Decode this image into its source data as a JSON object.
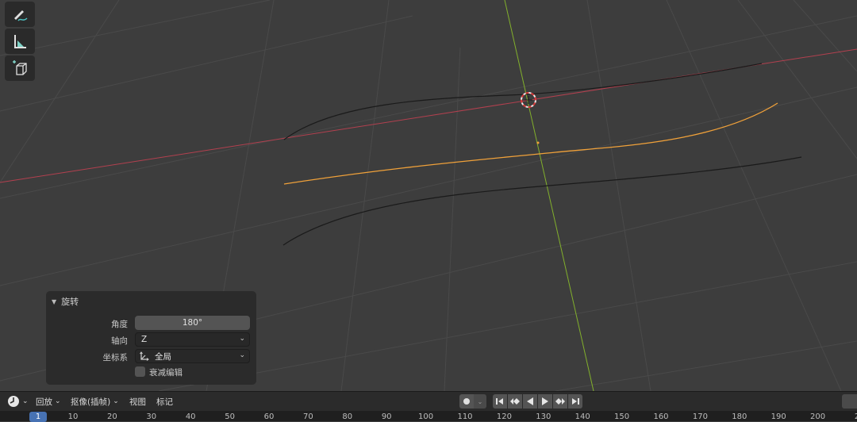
{
  "viewport": {
    "tools": [
      {
        "icon": "annotate-icon"
      },
      {
        "icon": "measure-icon"
      },
      {
        "icon": "add-cube-icon"
      }
    ]
  },
  "operator_panel": {
    "title": "旋转",
    "angle_label": "角度",
    "angle_value": "180°",
    "axis_label": "轴向",
    "axis_value": "Z",
    "orient_label": "坐标系",
    "orient_value": "全局",
    "proportional_label": "衰减编辑",
    "proportional_checked": false
  },
  "timeline": {
    "playback_label": "回放",
    "keying_label": "抠像(插帧)",
    "view_label": "视图",
    "marker_label": "标记",
    "current_frame": "1",
    "ticks": [
      "10",
      "20",
      "30",
      "40",
      "50",
      "60",
      "70",
      "80",
      "90",
      "100",
      "110",
      "120",
      "130",
      "140",
      "150",
      "160",
      "170",
      "180",
      "190",
      "200",
      "2"
    ]
  },
  "colors": {
    "x_axis": "#b3404f",
    "y_axis": "#82b02c",
    "selected_curve": "#f0a13a",
    "accent": "#4772b3"
  }
}
